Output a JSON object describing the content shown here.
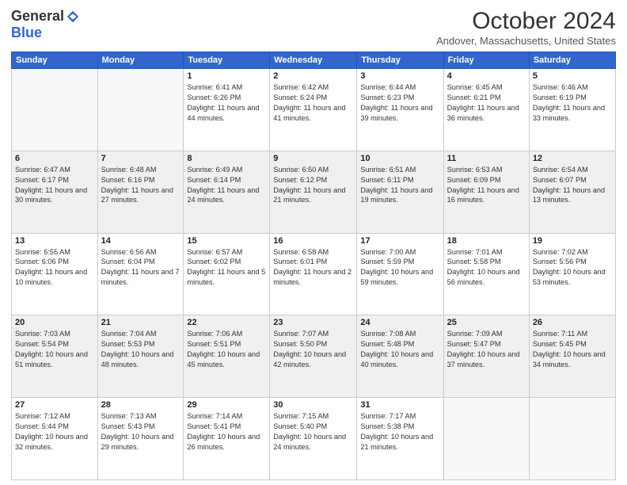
{
  "header": {
    "logo_general": "General",
    "logo_blue": "Blue",
    "month_title": "October 2024",
    "location": "Andover, Massachusetts, United States"
  },
  "weekdays": [
    "Sunday",
    "Monday",
    "Tuesday",
    "Wednesday",
    "Thursday",
    "Friday",
    "Saturday"
  ],
  "weeks": [
    [
      {
        "day": "",
        "info": ""
      },
      {
        "day": "",
        "info": ""
      },
      {
        "day": "1",
        "info": "Sunrise: 6:41 AM\nSunset: 6:26 PM\nDaylight: 11 hours and 44 minutes."
      },
      {
        "day": "2",
        "info": "Sunrise: 6:42 AM\nSunset: 6:24 PM\nDaylight: 11 hours and 41 minutes."
      },
      {
        "day": "3",
        "info": "Sunrise: 6:44 AM\nSunset: 6:23 PM\nDaylight: 11 hours and 39 minutes."
      },
      {
        "day": "4",
        "info": "Sunrise: 6:45 AM\nSunset: 6:21 PM\nDaylight: 11 hours and 36 minutes."
      },
      {
        "day": "5",
        "info": "Sunrise: 6:46 AM\nSunset: 6:19 PM\nDaylight: 11 hours and 33 minutes."
      }
    ],
    [
      {
        "day": "6",
        "info": "Sunrise: 6:47 AM\nSunset: 6:17 PM\nDaylight: 11 hours and 30 minutes."
      },
      {
        "day": "7",
        "info": "Sunrise: 6:48 AM\nSunset: 6:16 PM\nDaylight: 11 hours and 27 minutes."
      },
      {
        "day": "8",
        "info": "Sunrise: 6:49 AM\nSunset: 6:14 PM\nDaylight: 11 hours and 24 minutes."
      },
      {
        "day": "9",
        "info": "Sunrise: 6:50 AM\nSunset: 6:12 PM\nDaylight: 11 hours and 21 minutes."
      },
      {
        "day": "10",
        "info": "Sunrise: 6:51 AM\nSunset: 6:11 PM\nDaylight: 11 hours and 19 minutes."
      },
      {
        "day": "11",
        "info": "Sunrise: 6:53 AM\nSunset: 6:09 PM\nDaylight: 11 hours and 16 minutes."
      },
      {
        "day": "12",
        "info": "Sunrise: 6:54 AM\nSunset: 6:07 PM\nDaylight: 11 hours and 13 minutes."
      }
    ],
    [
      {
        "day": "13",
        "info": "Sunrise: 6:55 AM\nSunset: 6:06 PM\nDaylight: 11 hours and 10 minutes."
      },
      {
        "day": "14",
        "info": "Sunrise: 6:56 AM\nSunset: 6:04 PM\nDaylight: 11 hours and 7 minutes."
      },
      {
        "day": "15",
        "info": "Sunrise: 6:57 AM\nSunset: 6:02 PM\nDaylight: 11 hours and 5 minutes."
      },
      {
        "day": "16",
        "info": "Sunrise: 6:58 AM\nSunset: 6:01 PM\nDaylight: 11 hours and 2 minutes."
      },
      {
        "day": "17",
        "info": "Sunrise: 7:00 AM\nSunset: 5:59 PM\nDaylight: 10 hours and 59 minutes."
      },
      {
        "day": "18",
        "info": "Sunrise: 7:01 AM\nSunset: 5:58 PM\nDaylight: 10 hours and 56 minutes."
      },
      {
        "day": "19",
        "info": "Sunrise: 7:02 AM\nSunset: 5:56 PM\nDaylight: 10 hours and 53 minutes."
      }
    ],
    [
      {
        "day": "20",
        "info": "Sunrise: 7:03 AM\nSunset: 5:54 PM\nDaylight: 10 hours and 51 minutes."
      },
      {
        "day": "21",
        "info": "Sunrise: 7:04 AM\nSunset: 5:53 PM\nDaylight: 10 hours and 48 minutes."
      },
      {
        "day": "22",
        "info": "Sunrise: 7:06 AM\nSunset: 5:51 PM\nDaylight: 10 hours and 45 minutes."
      },
      {
        "day": "23",
        "info": "Sunrise: 7:07 AM\nSunset: 5:50 PM\nDaylight: 10 hours and 42 minutes."
      },
      {
        "day": "24",
        "info": "Sunrise: 7:08 AM\nSunset: 5:48 PM\nDaylight: 10 hours and 40 minutes."
      },
      {
        "day": "25",
        "info": "Sunrise: 7:09 AM\nSunset: 5:47 PM\nDaylight: 10 hours and 37 minutes."
      },
      {
        "day": "26",
        "info": "Sunrise: 7:11 AM\nSunset: 5:45 PM\nDaylight: 10 hours and 34 minutes."
      }
    ],
    [
      {
        "day": "27",
        "info": "Sunrise: 7:12 AM\nSunset: 5:44 PM\nDaylight: 10 hours and 32 minutes."
      },
      {
        "day": "28",
        "info": "Sunrise: 7:13 AM\nSunset: 5:43 PM\nDaylight: 10 hours and 29 minutes."
      },
      {
        "day": "29",
        "info": "Sunrise: 7:14 AM\nSunset: 5:41 PM\nDaylight: 10 hours and 26 minutes."
      },
      {
        "day": "30",
        "info": "Sunrise: 7:15 AM\nSunset: 5:40 PM\nDaylight: 10 hours and 24 minutes."
      },
      {
        "day": "31",
        "info": "Sunrise: 7:17 AM\nSunset: 5:38 PM\nDaylight: 10 hours and 21 minutes."
      },
      {
        "day": "",
        "info": ""
      },
      {
        "day": "",
        "info": ""
      }
    ]
  ],
  "row_shading": [
    false,
    true,
    false,
    true,
    false
  ]
}
